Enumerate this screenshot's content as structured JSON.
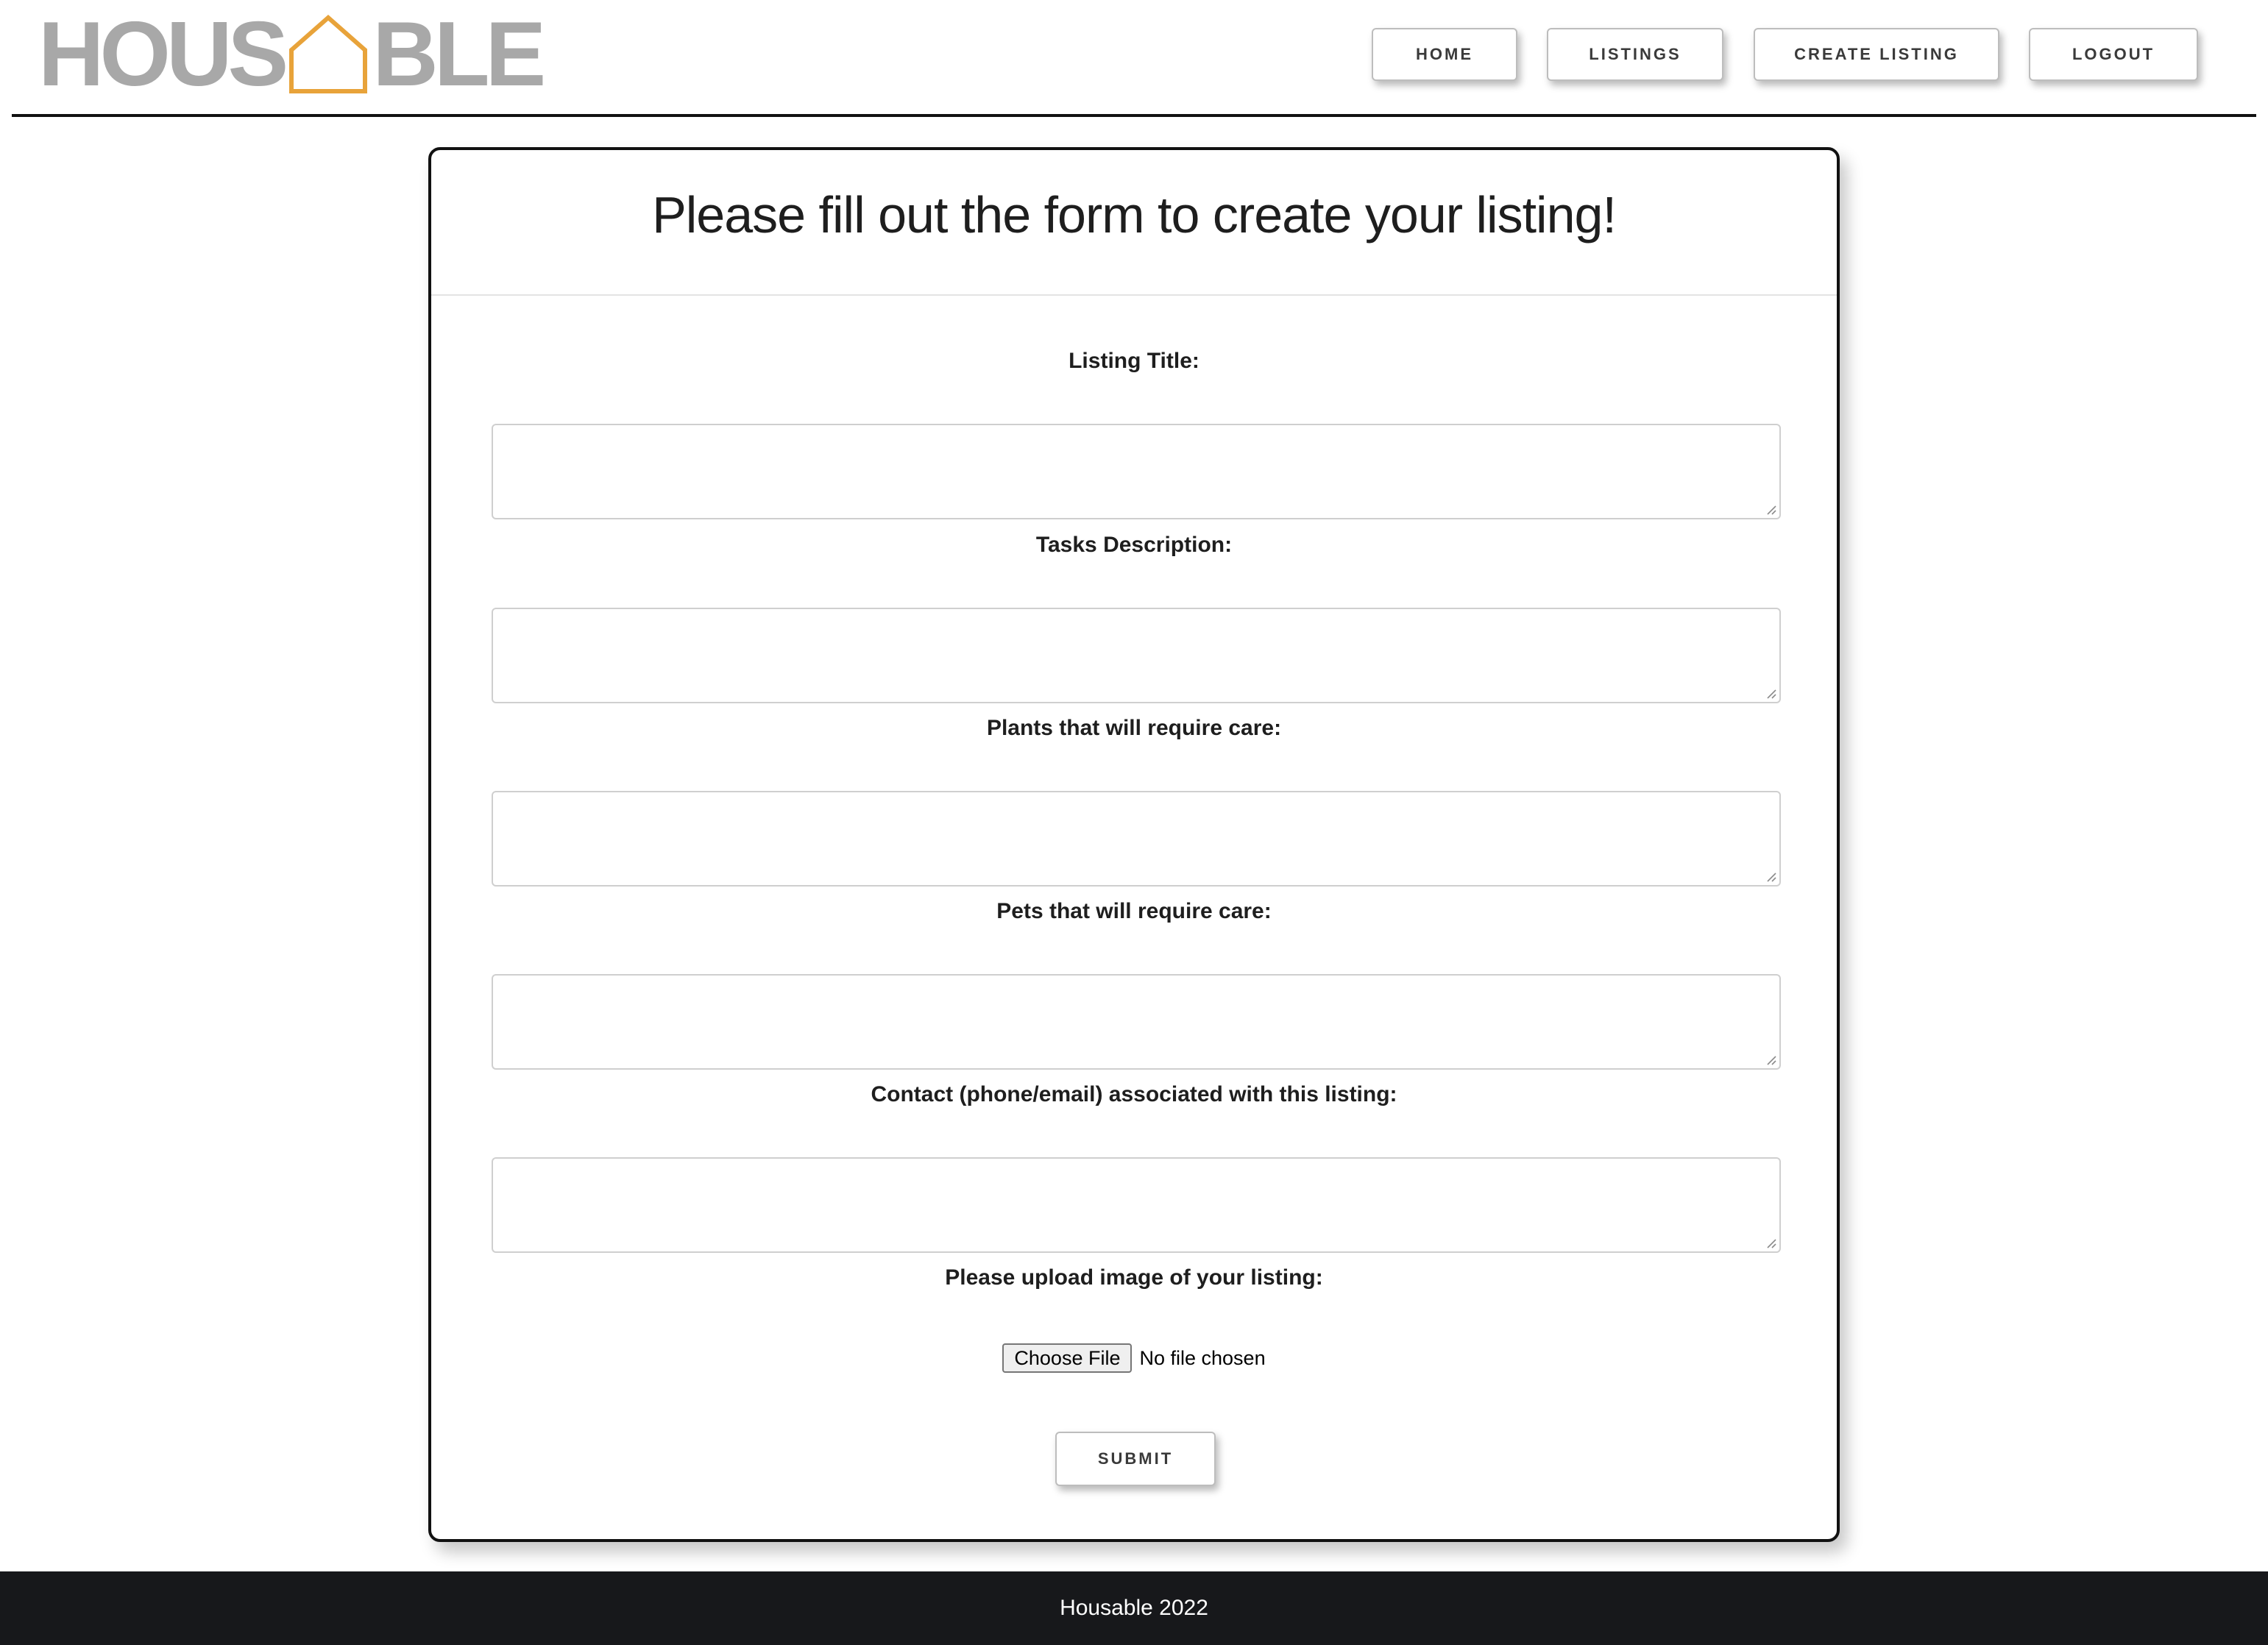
{
  "brand": {
    "logo_left": "HOUS",
    "logo_right": "BLE",
    "logo_icon": "house-icon",
    "logo_color": "#a8a8a8",
    "icon_color": "#e8a33a"
  },
  "nav": {
    "home": "HOME",
    "listings": "LISTINGS",
    "create_listing": "CREATE LISTING",
    "logout": "LOGOUT"
  },
  "form": {
    "title": "Please fill out the form to create your listing!",
    "fields": [
      {
        "label": "Listing Title:",
        "value": ""
      },
      {
        "label": "Tasks Description:",
        "value": ""
      },
      {
        "label": "Plants that will require care:",
        "value": ""
      },
      {
        "label": "Pets that will require care:",
        "value": ""
      },
      {
        "label": "Contact (phone/email) associated with this listing:",
        "value": ""
      }
    ],
    "upload_label": "Please upload image of your listing:",
    "choose_file_label": "Choose File",
    "file_status": "No file chosen",
    "submit_label": "SUBMIT"
  },
  "footer": {
    "text": "Housable 2022",
    "background": "#17181b"
  }
}
